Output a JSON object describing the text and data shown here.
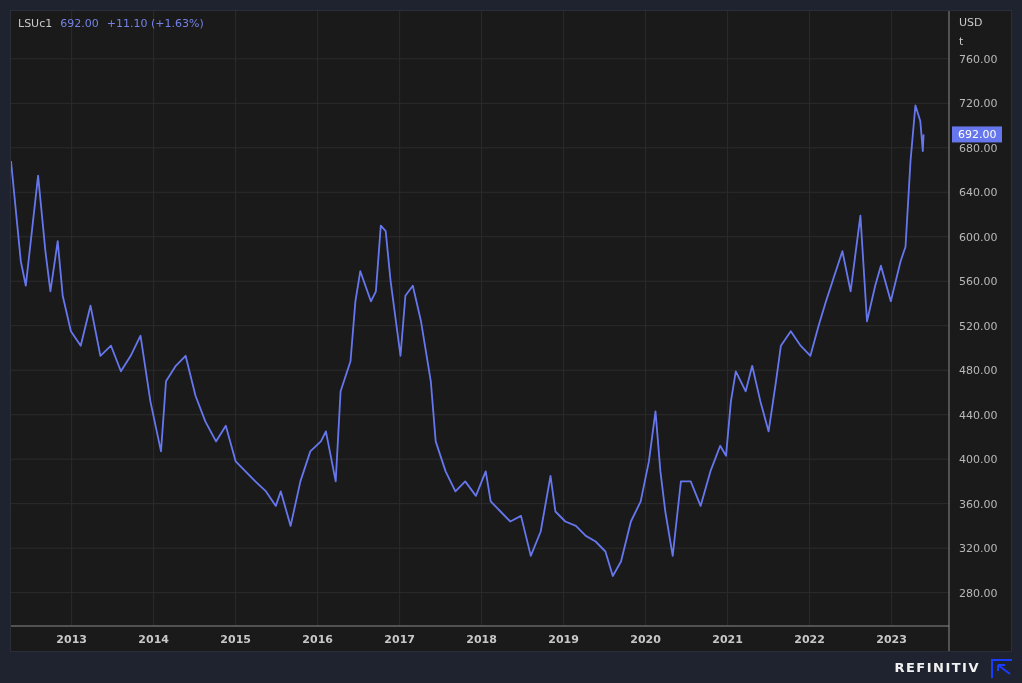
{
  "header": {
    "price": "692.00",
    "change": "+11.10 (+1.63%)"
  },
  "axis_units": [
    "USD",
    "t"
  ],
  "price_tag": "692.00",
  "chart_data": {
    "type": "line",
    "grid": true,
    "xlim": [
      2012.26,
      2023.7
    ],
    "ylim": [
      250,
      803
    ],
    "xticks": [
      2013,
      2014,
      2015,
      2016,
      2017,
      2018,
      2019,
      2020,
      2021,
      2022,
      2023
    ],
    "yticks": [
      {
        "value": 280,
        "label": "280.00"
      },
      {
        "value": 320,
        "label": "320.00"
      },
      {
        "value": 360,
        "label": "360.00"
      },
      {
        "value": 400,
        "label": "400.00"
      },
      {
        "value": 440,
        "label": "440.00"
      },
      {
        "value": 480,
        "label": "480.00"
      },
      {
        "value": 520,
        "label": "520.00"
      },
      {
        "value": 560,
        "label": "560.00"
      },
      {
        "value": 600,
        "label": "600.00"
      },
      {
        "value": 640,
        "label": "640.00"
      },
      {
        "value": 680,
        "label": "680.00"
      },
      {
        "value": 720,
        "label": "720.00"
      },
      {
        "value": 760,
        "label": "760.00"
      }
    ],
    "x": [
      2012.26,
      2012.38,
      2012.44,
      2012.59,
      2012.68,
      2012.74,
      2012.83,
      2012.89,
      2012.99,
      2013.11,
      2013.23,
      2013.35,
      2013.48,
      2013.6,
      2013.72,
      2013.84,
      2013.96,
      2014.09,
      2014.15,
      2014.27,
      2014.39,
      2014.51,
      2014.63,
      2014.76,
      2014.88,
      2015.0,
      2015.12,
      2015.24,
      2015.37,
      2015.49,
      2015.55,
      2015.67,
      2015.79,
      2015.91,
      2016.04,
      2016.1,
      2016.22,
      2016.28,
      2016.4,
      2016.46,
      2016.52,
      2016.65,
      2016.71,
      2016.77,
      2016.83,
      2016.89,
      2017.01,
      2017.07,
      2017.16,
      2017.26,
      2017.38,
      2017.44,
      2017.56,
      2017.68,
      2017.8,
      2017.93,
      2018.05,
      2018.11,
      2018.23,
      2018.35,
      2018.48,
      2018.6,
      2018.72,
      2018.84,
      2018.9,
      2019.02,
      2019.15,
      2019.27,
      2019.39,
      2019.51,
      2019.6,
      2019.7,
      2019.82,
      2019.94,
      2020.04,
      2020.12,
      2020.18,
      2020.24,
      2020.33,
      2020.43,
      2020.55,
      2020.67,
      2020.79,
      2020.91,
      2020.98,
      2021.04,
      2021.1,
      2021.22,
      2021.3,
      2021.4,
      2021.5,
      2021.59,
      2021.65,
      2021.77,
      2021.89,
      2022.01,
      2022.11,
      2022.2,
      2022.32,
      2022.4,
      2022.5,
      2022.62,
      2022.7,
      2022.8,
      2022.87,
      2022.99,
      2023.11,
      2023.17,
      2023.23,
      2023.29,
      2023.35,
      2023.38,
      2023.39
    ],
    "series": [
      {
        "name": "LSUc1",
        "color": "#6677ee",
        "values": [
          668,
          578,
          556,
          655,
          587,
          551,
          596,
          547,
          515,
          502,
          538,
          493,
          502,
          479,
          493,
          511,
          452,
          407,
          470,
          484,
          493,
          457,
          434,
          416,
          430,
          398,
          389,
          380,
          371,
          358,
          371,
          340,
          380,
          407,
          416,
          425,
          380,
          461,
          488,
          542,
          569,
          542,
          551,
          610,
          605,
          560,
          493,
          547,
          556,
          524,
          470,
          416,
          389,
          371,
          380,
          367,
          389,
          362,
          353,
          344,
          349,
          313,
          335,
          385,
          353,
          344,
          340,
          331,
          326,
          317,
          295,
          308,
          344,
          362,
          398,
          443,
          389,
          353,
          313,
          380,
          380,
          358,
          389,
          412,
          403,
          452,
          479,
          461,
          484,
          452,
          425,
          470,
          502,
          515,
          502,
          493,
          520,
          542,
          569,
          587,
          551,
          619,
          524,
          556,
          574,
          542,
          578,
          591,
          668,
          718,
          704,
          677,
          692
        ]
      }
    ]
  },
  "footer": {
    "brand": "REFINITIV"
  }
}
